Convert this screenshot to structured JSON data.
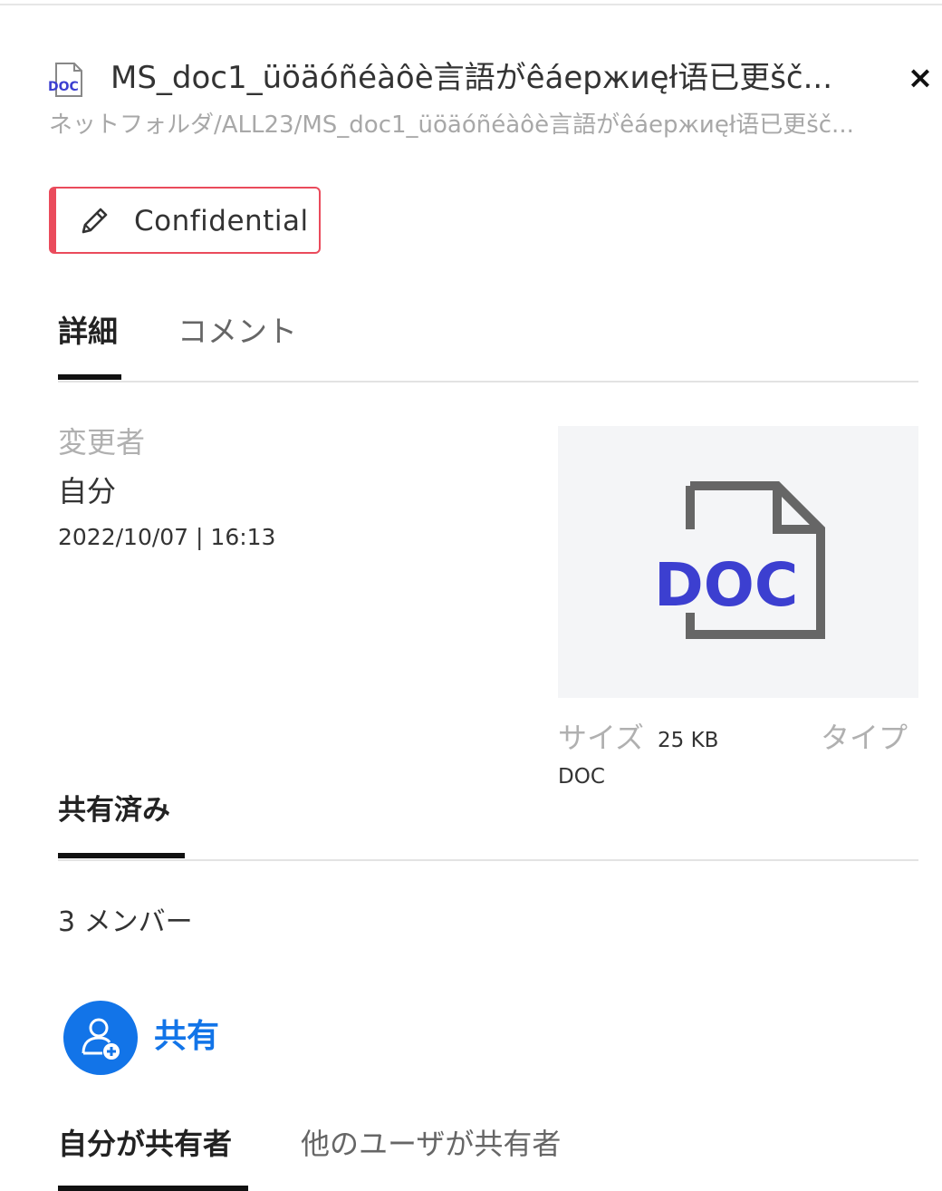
{
  "header": {
    "file_icon": "doc-file-icon",
    "file_icon_text": "DOC",
    "title": "MS_doc1_üöäóñéàôè言語がêáeржиęł语已更šč...",
    "path": "ネットフォルダ/ALL23/MS_doc1_üöäóñéàôè言語がêáeржиęł语已更šč...",
    "close_label": "×"
  },
  "classification": {
    "icon": "pencil-icon",
    "label": "Confidential",
    "color": "#ea4b5c"
  },
  "tabs": [
    {
      "label": "詳細",
      "active": true
    },
    {
      "label": "コメント",
      "active": false
    }
  ],
  "details": {
    "modified_by_label": "変更者",
    "modified_by_value": "自分",
    "modified_datetime": "2022/10/07 | 16:13",
    "preview_text": "DOC",
    "size_label": "サイズ",
    "size_value": "25 KB",
    "type_label": "タイプ",
    "type_value": "DOC"
  },
  "sharing": {
    "heading": "共有済み",
    "members": "3 メンバー",
    "share_icon": "add-user-icon",
    "share_label": "共有",
    "share_color": "#1274e8"
  },
  "share_tabs": [
    {
      "label": "自分が共有者",
      "active": true
    },
    {
      "label": "他のユーザが共有者",
      "active": false
    }
  ]
}
